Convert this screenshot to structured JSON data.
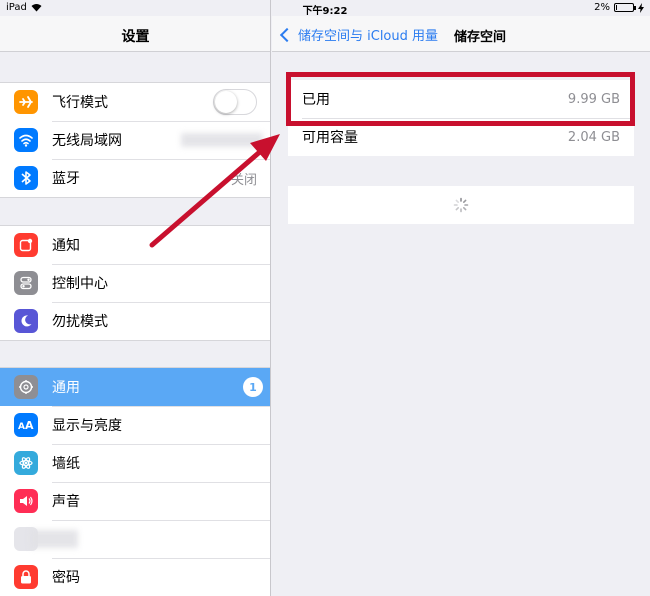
{
  "status_bar": {
    "device": "iPad",
    "time": "下午9:22",
    "battery_percent": "2%",
    "battery_level": 0.02
  },
  "left_pane": {
    "title": "设置",
    "groups": [
      [
        {
          "label": "飞行模式",
          "icon": "airplane-icon",
          "color": "#ff9500",
          "control": "toggle",
          "toggle_on": false
        },
        {
          "label": "无线局域网",
          "icon": "wifi-icon",
          "color": "#007aff",
          "value": "",
          "blurred": true
        },
        {
          "label": "蓝牙",
          "icon": "bluetooth-icon",
          "color": "#007aff",
          "value": "关闭"
        }
      ],
      [
        {
          "label": "通知",
          "icon": "notification-icon",
          "color": "#ff3b30"
        },
        {
          "label": "控制中心",
          "icon": "control-center-icon",
          "color": "#8e8e93"
        },
        {
          "label": "勿扰模式",
          "icon": "moon-icon",
          "color": "#5856d6"
        }
      ],
      [
        {
          "label": "通用",
          "icon": "gear-icon",
          "color": "#8e8e93",
          "selected": true,
          "badge": "1"
        },
        {
          "label": "显示与亮度",
          "icon": "display-icon",
          "color": "#007aff"
        },
        {
          "label": "墙纸",
          "icon": "wallpaper-icon",
          "color": "#34aadc"
        },
        {
          "label": "声音",
          "icon": "sound-icon",
          "color": "#ff2d55"
        },
        {
          "label": "",
          "icon": "blurred-icon",
          "color": "#e5e5ea",
          "blurred": true
        },
        {
          "label": "密码",
          "icon": "passcode-icon",
          "color": "#ff3b30"
        }
      ]
    ]
  },
  "right_pane": {
    "back_label": "储存空间与 iCloud 用量",
    "title": "储存空间",
    "storage": [
      {
        "label": "已用",
        "value": "9.99 GB"
      },
      {
        "label": "可用容量",
        "value": "2.04 GB"
      }
    ]
  },
  "colors": {
    "accent": "#2b7cf0",
    "selected_row": "#5aa8f5",
    "annotation": "#c8102e"
  }
}
